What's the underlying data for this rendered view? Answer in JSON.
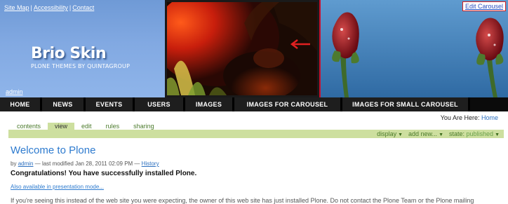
{
  "site_actions": {
    "site_map": "Site Map",
    "separator": "|",
    "accessibility": "Accessibility",
    "contact": "Contact"
  },
  "brand": {
    "title": "Brio Skin",
    "subtitle": "PLONE THEMES BY QUINTAGROUP"
  },
  "user": {
    "name": "admin"
  },
  "carousel": {
    "edit_link": "Edit Carousel",
    "arrow_icon": "left-arrow-icon",
    "arrow_color": "#e02020"
  },
  "global_nav": {
    "tabs": [
      {
        "label": "HOME"
      },
      {
        "label": "NEWS"
      },
      {
        "label": "EVENTS"
      },
      {
        "label": "USERS"
      },
      {
        "label": "IMAGES"
      },
      {
        "label": "IMAGES FOR CAROUSEL"
      },
      {
        "label": "IMAGES FOR SMALL CAROUSEL"
      }
    ]
  },
  "breadcrumbs": {
    "prefix": "You Are Here:",
    "home": "Home"
  },
  "content_views": {
    "tabs": [
      {
        "label": "contents"
      },
      {
        "label": "view"
      },
      {
        "label": "edit"
      },
      {
        "label": "rules"
      },
      {
        "label": "sharing"
      }
    ],
    "selected": "view"
  },
  "content_actions": {
    "display": "display",
    "add_new": "add new...",
    "state_label": "state:",
    "state_value": "published",
    "dropdown_icon": "triangle-down-icon"
  },
  "document": {
    "title": "Welcome to Plone",
    "byline": {
      "by": "by",
      "author": "admin",
      "modified": "— last modified Jan 28, 2011 02:09 PM —",
      "history": "History"
    },
    "congrats": "Congratulations! You have successfully installed Plone.",
    "presentation_link": "Also available in presentation mode...",
    "intro": "If you're seeing this instead of the web site you were expecting, the owner of this web site has just installed Plone. Do not contact the Plone Team or the Plone mailing"
  },
  "colors": {
    "brand_blue": "#82a9e2",
    "nav_background": "#0b0b0b",
    "view_tab_green": "#cddf9f",
    "link_blue": "#2e7bcf",
    "carousel_highlight": "#c8102e"
  }
}
